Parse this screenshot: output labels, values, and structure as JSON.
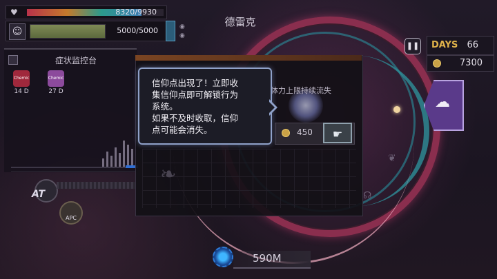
{
  "top_hud": {
    "hp_text": "8320/9930",
    "hp_fraction": 0.84,
    "sp_text": "5000/5000",
    "sp_fraction": 1.0,
    "country_name": "德雷克"
  },
  "monitor": {
    "title": "症状监控台",
    "symptoms": [
      {
        "badge": "Chemic",
        "days": "14 D",
        "color": "#a0283c"
      },
      {
        "badge": "Chemic",
        "days": "27 D",
        "color": "#8c4a9c"
      }
    ]
  },
  "ability": {
    "at_label": "AT",
    "apc_label": "APC"
  },
  "right_hud": {
    "days_label": "DAYS",
    "days_value": "66",
    "coins_value": "7300"
  },
  "popup": {
    "subtitle": "增体力上限持续流失",
    "upgrade_cost": "450"
  },
  "tooltip": {
    "lines": [
      "信仰点出现了！立即收",
      "集信仰点即可解锁行为",
      "系统。",
      "如果不及时收取，信仰",
      "点可能会消失。"
    ]
  },
  "bottom": {
    "population": "590M"
  },
  "icons": {
    "hp": "heart-icon",
    "sp": "person-icon",
    "pause": "pause-icon",
    "coin": "coin-icon",
    "brain": "brain-icon",
    "virus": "virus-icon"
  }
}
